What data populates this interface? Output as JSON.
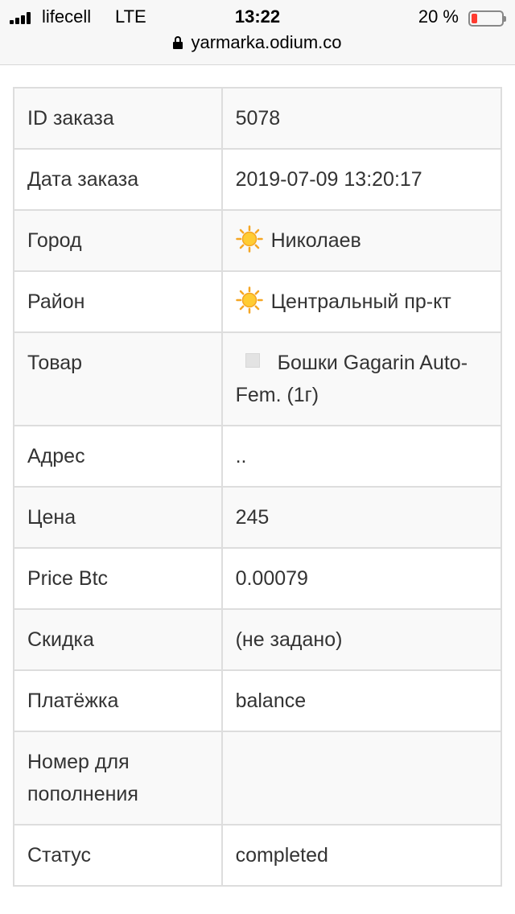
{
  "status_bar": {
    "carrier": "lifecell",
    "network": "LTE",
    "time": "13:22",
    "battery_percent": "20 %",
    "battery_level": 0.2,
    "battery_color": "#ff3b30"
  },
  "address_bar": {
    "url": "yarmarka.odium.co",
    "lock_icon": "lock-icon"
  },
  "order": {
    "rows": [
      {
        "label": "ID заказа",
        "value": "5078"
      },
      {
        "label": "Дата заказа",
        "value": "2019-07-09 13:20:17"
      },
      {
        "label": "Город",
        "value": "Николаев",
        "icon": "sun-icon"
      },
      {
        "label": "Район",
        "value": "Центральный пр-кт",
        "icon": "sun-icon"
      },
      {
        "label": "Товар",
        "value": "Бошки Gagarin Auto-Fem. (1г)",
        "icon": "product-image-icon"
      },
      {
        "label": "Адрес",
        "value": ".."
      },
      {
        "label": "Цена",
        "value": "245"
      },
      {
        "label": "Price Btc",
        "value": "0.00079"
      },
      {
        "label": "Скидка",
        "value": "(не задано)"
      },
      {
        "label": "Платёжка",
        "value": "balance"
      },
      {
        "label": "Номер для пополнения",
        "value": ""
      },
      {
        "label": "Статус",
        "value": "completed"
      }
    ]
  }
}
